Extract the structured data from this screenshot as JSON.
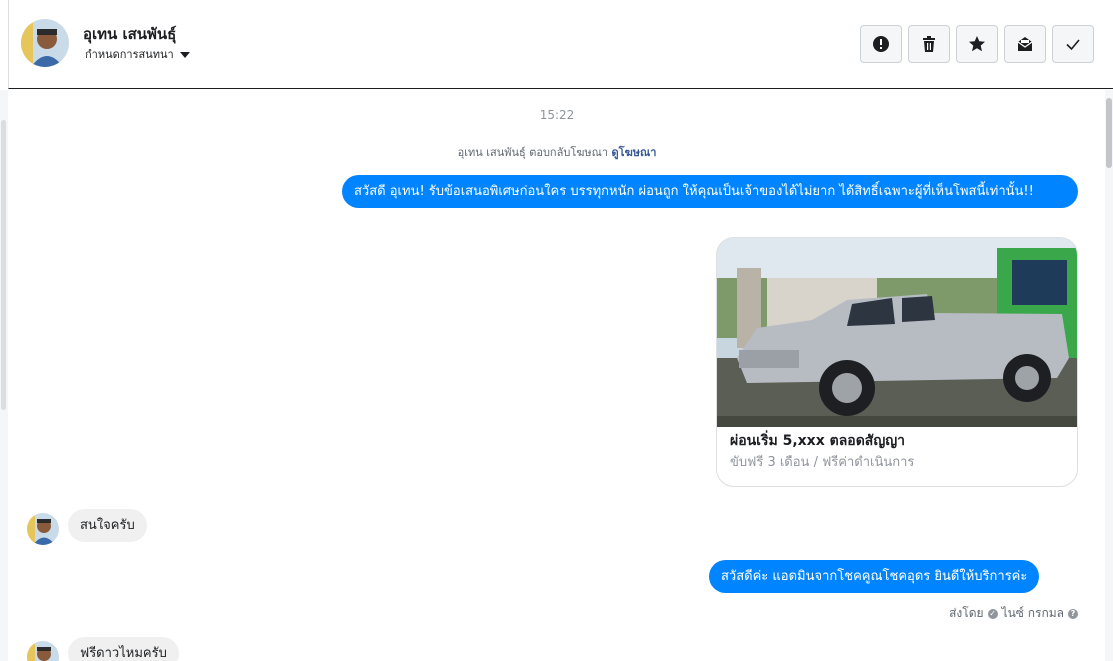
{
  "header": {
    "contact_name": "อุเทน เสนพันธุ์",
    "assign_label": "กำหนดการสนทนา",
    "actions": [
      {
        "name": "mark-spam-button",
        "icon": "exclamation-icon"
      },
      {
        "name": "delete-button",
        "icon": "trash-icon"
      },
      {
        "name": "star-button",
        "icon": "star-icon"
      },
      {
        "name": "mark-unread-button",
        "icon": "envelope-icon"
      },
      {
        "name": "mark-done-button",
        "icon": "check-icon"
      }
    ]
  },
  "thread": {
    "timestamp": "15:22",
    "reply_note": {
      "text": "อุเทน เสนพันธุ์ ตอบกลับโฆษณา ",
      "link": "ดูโฆษณา"
    },
    "messages": [
      {
        "from": "page",
        "text": "สวัสดี อุเทน! รับข้อเสนอพิเศษก่อนใคร บรรทุกหนัก ผ่อนถูก ให้คุณเป็นเจ้าของได้ไม่ยาก ได้สิทธิ์เฉพาะผู้ที่เห็นโพสนี้เท่านั้น!!"
      },
      {
        "from": "page",
        "card": {
          "title": "ผ่อนเริ่ม 5,xxx ตลอดสัญญา",
          "subtitle": "ขับฟรี 3 เดือน / ฟรีค่าดำเนินการ"
        }
      },
      {
        "from": "user",
        "text": "สนใจครับ"
      },
      {
        "from": "page",
        "text": "สวัสดีค่ะ แอดมินจากโชคคูณโชคอุดร ยินดีให้บริการค่ะ",
        "sent_by_label": "ส่งโดย",
        "agent": "ไนซ์ กรกมล"
      },
      {
        "from": "user",
        "text": "ฟรีดาวไหมครับ"
      }
    ]
  },
  "colors": {
    "messenger_blue": "#0084ff",
    "incoming_bubble": "#f1f0f0",
    "link": "#385898"
  }
}
